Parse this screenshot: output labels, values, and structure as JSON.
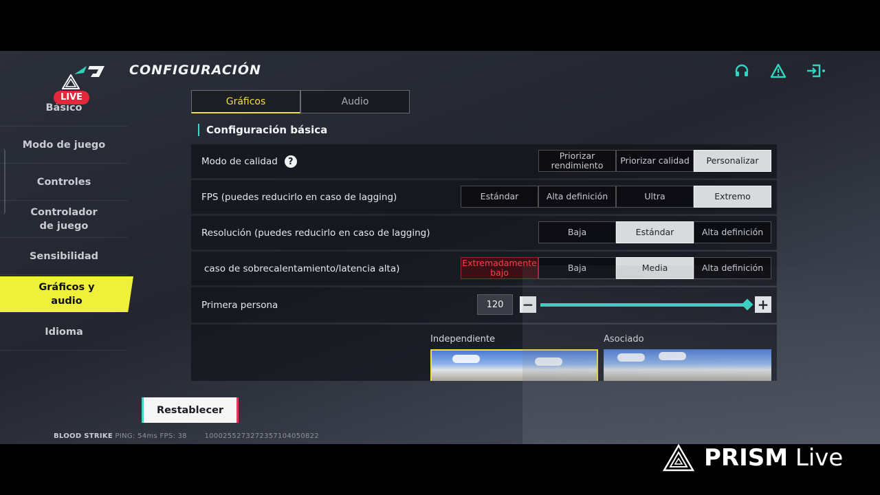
{
  "header": {
    "title": "CONFIGURACIÓN"
  },
  "live_badge": "LIVE",
  "sidebar": {
    "items": [
      {
        "label": "Básico"
      },
      {
        "label": "Modo de juego"
      },
      {
        "label": "Controles"
      },
      {
        "label": "Controlador de juego"
      },
      {
        "label": "Sensibilidad"
      },
      {
        "label": "Gráficos y audio"
      },
      {
        "label": "Idioma"
      }
    ],
    "active_index": 5
  },
  "tabs": [
    {
      "label": "Gráficos"
    },
    {
      "label": "Audio"
    }
  ],
  "section": {
    "title": "Configuración básica"
  },
  "settings": {
    "quality": {
      "label": "Modo de calidad",
      "options": [
        "Priorizar rendimiento",
        "Priorizar calidad",
        "Personalizar"
      ],
      "selected": "Personalizar"
    },
    "fps": {
      "label": "FPS (puedes reducirlo en caso de lagging)",
      "options": [
        "Estándar",
        "Alta definición",
        "Ultra",
        "Extremo"
      ],
      "selected": "Extremo"
    },
    "resolution": {
      "label": "Resolución (puedes reducirlo en caso de lagging)",
      "options": [
        "Baja",
        "Estándar",
        "Alta definición"
      ],
      "selected": "Estándar"
    },
    "graphics": {
      "label": "caso de sobrecalentamiento/latencia alta)",
      "options": [
        "Extremadamente bajo",
        "Baja",
        "Media",
        "Alta definición"
      ],
      "selected": "Media"
    },
    "fov": {
      "label": "Primera persona",
      "value": "120",
      "fraction": 0.99
    },
    "view_modes": [
      {
        "label": "Independiente"
      },
      {
        "label": "Asociado"
      }
    ]
  },
  "reset_button": "Restablecer",
  "status": {
    "game": "BLOOD STRIKE",
    "ping": "PING: 54ms",
    "fps": "FPS: 38",
    "id": "1000255273272357104050822"
  },
  "watermark": {
    "brand": "PRISM",
    "product": "Live"
  },
  "colors": {
    "accent_yellow": "#eef03a",
    "accent_cyan": "#36d7c6",
    "live_red": "#e2283a",
    "warning_red": "#ff3d45"
  },
  "icons": [
    "headset-icon",
    "warning-icon",
    "exit-icon",
    "question-icon",
    "minus-icon",
    "plus-icon",
    "prism-logo-icon"
  ]
}
